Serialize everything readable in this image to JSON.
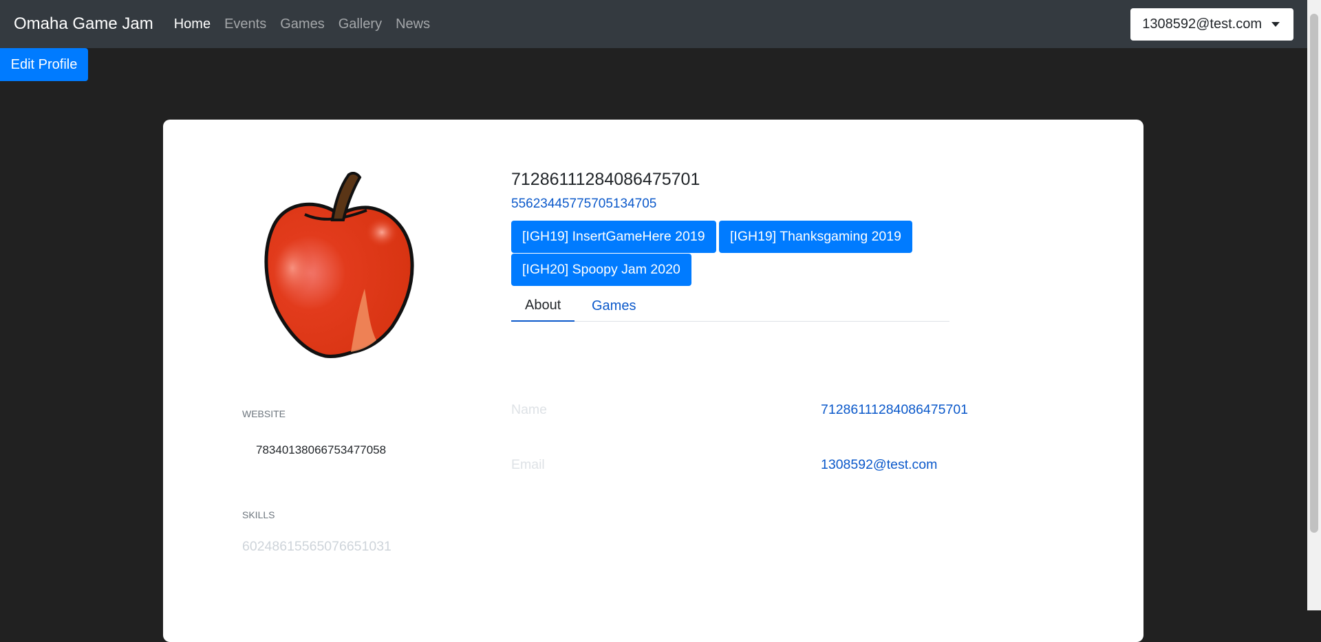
{
  "navbar": {
    "brand": "Omaha Game Jam",
    "links": [
      "Home",
      "Events",
      "Games",
      "Gallery",
      "News"
    ],
    "user_email": "1308592@test.com"
  },
  "edit_profile_label": "Edit Profile",
  "profile": {
    "display_name": "71286111284086475701",
    "link_text": "55623445775705134705",
    "events": [
      "[IGH19] InsertGameHere 2019",
      "[IGH19] Thanksgaming 2019",
      "[IGH20] Spoopy Jam 2020"
    ],
    "tabs": [
      "About",
      "Games"
    ],
    "website_label": "WEBSITE",
    "website_value": "78340138066753477058",
    "skills_label": "SKILLS",
    "skills_value": "60248615565076651031",
    "about": {
      "name_label": "Name",
      "name_value": "71286111284086475701",
      "email_label": "Email",
      "email_value": "1308592@test.com"
    }
  },
  "colors": {
    "navbar_bg": "#343a40",
    "page_bg": "#212121",
    "primary": "#007bff",
    "link": "#0a58ca"
  }
}
